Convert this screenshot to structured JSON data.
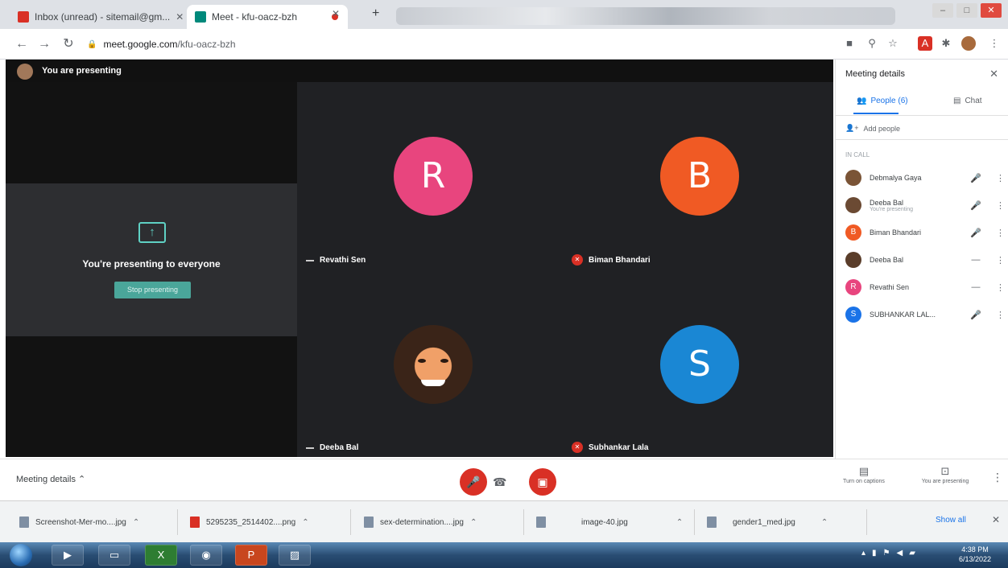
{
  "browser": {
    "tabs": [
      {
        "label": "Inbox (unread) - sitemail@gm..."
      },
      {
        "label": "Meet - kfu-oacz-bzh"
      }
    ],
    "url_host": "meet.google.com",
    "url_path": "/kfu-oacz-bzh"
  },
  "meet": {
    "presenting_banner": "You are presenting",
    "present_message": "You're presenting to everyone",
    "stop_button": "Stop presenting",
    "tiles": [
      {
        "initial": "R",
        "name": "Revathi Sen",
        "color": "#e8457e",
        "muted": false
      },
      {
        "initial": "B",
        "name": "Biman Bhandari",
        "color": "#f05a24",
        "muted": true
      },
      {
        "initial": "",
        "name": "Deeba Bal",
        "color": "",
        "muted": false
      },
      {
        "initial": "S",
        "name": "Subhankar Lala",
        "color": "#1a87d4",
        "muted": true
      }
    ]
  },
  "panel": {
    "title": "Meeting details",
    "tab_people": "People (6)",
    "tab_chat": "Chat",
    "add_people": "Add people",
    "section_label": "IN CALL",
    "people": [
      {
        "name": "Debmalya Gaya",
        "sub": "",
        "avatar_color": "#7a5436",
        "initial": "",
        "mic": "🎤"
      },
      {
        "name": "Deeba Bal",
        "sub": "You're presenting",
        "avatar_color": "#6b4a33",
        "initial": "",
        "mic": "🎤"
      },
      {
        "name": "Biman Bhandari",
        "sub": "",
        "avatar_color": "#f05a24",
        "initial": "B",
        "mic": "🎤"
      },
      {
        "name": "Deeba Bal",
        "sub": "",
        "avatar_color": "#5a3d2a",
        "initial": "",
        "mic": "—"
      },
      {
        "name": "Revathi Sen",
        "sub": "",
        "avatar_color": "#e8457e",
        "initial": "R",
        "mic": "—"
      },
      {
        "name": "SUBHANKAR LAL...",
        "sub": "",
        "avatar_color": "#1a73e8",
        "initial": "S",
        "mic": "🎤"
      }
    ]
  },
  "controls": {
    "meeting_details": "Meeting details ⌃",
    "captions": "Turn on captions",
    "presenting": "You are presenting"
  },
  "downloads": [
    {
      "name": "Screenshot-Mer-mo....jpg"
    },
    {
      "name": "5295235_2514402....png"
    },
    {
      "name": "sex-determination....jpg"
    },
    {
      "name": "image-40.jpg"
    },
    {
      "name": "gender1_med.jpg"
    }
  ],
  "downloads_show_all": "Show all",
  "clock": {
    "time": "4:38 PM",
    "date": "6/13/2022"
  }
}
